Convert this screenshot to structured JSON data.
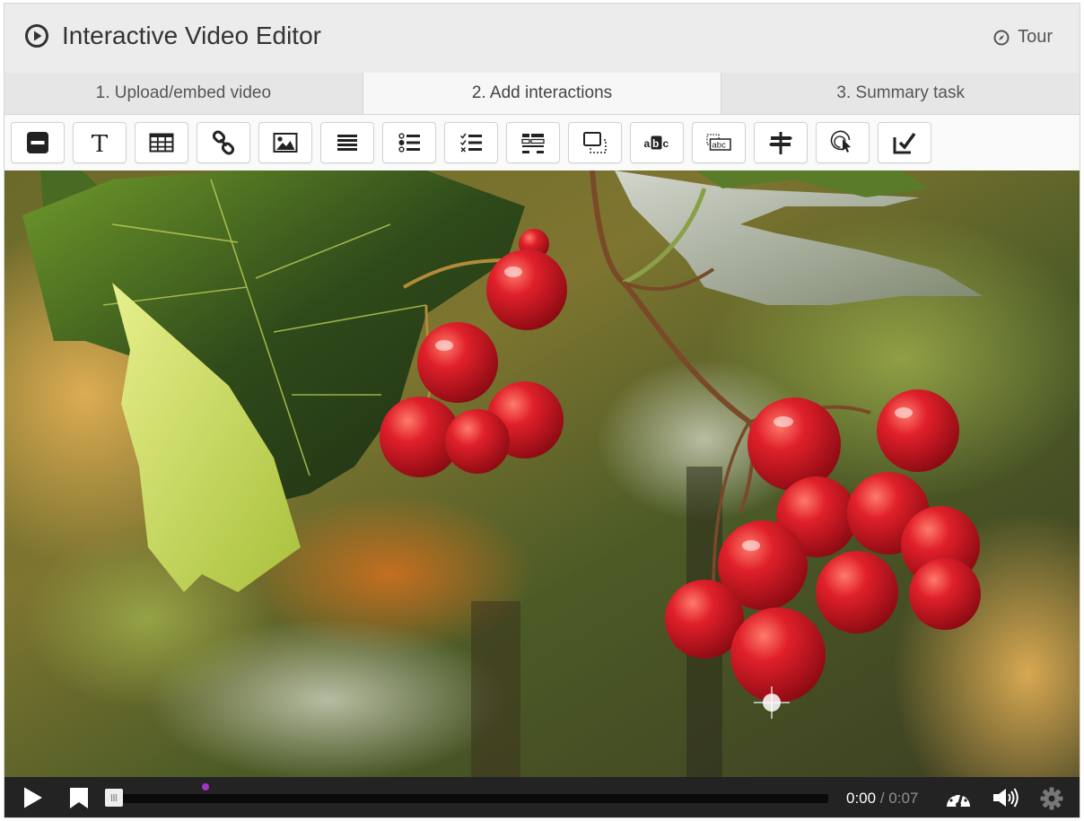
{
  "header": {
    "title": "Interactive Video Editor",
    "title_icon": "play-circle-icon",
    "tour_label": "Tour",
    "tour_icon": "compass-icon"
  },
  "tabs": [
    {
      "label": "1. Upload/embed video",
      "active": false
    },
    {
      "label": "2. Add interactions",
      "active": true
    },
    {
      "label": "3. Summary task",
      "active": false
    }
  ],
  "toolbar": {
    "tools": [
      "label-icon",
      "text-icon",
      "table-icon",
      "link-icon",
      "image-icon",
      "statements-icon",
      "single-choice-icon",
      "multiple-choice-icon",
      "true-false-icon",
      "drag-and-drop-icon",
      "fill-in-blanks-icon",
      "drag-text-icon",
      "crossroads-icon",
      "navigation-hotspot-icon",
      "submit-screen-icon"
    ]
  },
  "player": {
    "current_time": "0:00",
    "separator": " / ",
    "duration": "0:07",
    "progress": 0,
    "marker_position": 0.15,
    "colors": {
      "bar": "#232323",
      "marker": "#a334c6"
    }
  }
}
